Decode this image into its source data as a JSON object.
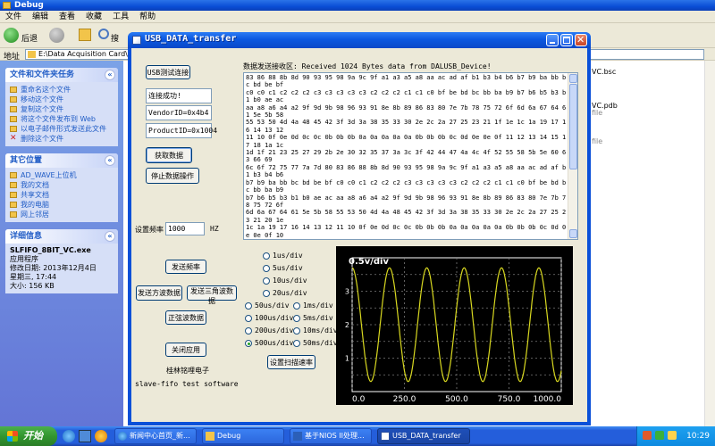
{
  "explorer": {
    "title": "Debug",
    "menu": [
      "文件",
      "编辑",
      "查看",
      "收藏",
      "工具",
      "帮助"
    ],
    "toolbar": {
      "back": "后退",
      "search": "搜"
    },
    "address_label": "地址",
    "address_value": "E:\\Data Acquisition Card\\",
    "file_tasks": {
      "title": "文件和文件夹任务",
      "items": [
        "重命名这个文件",
        "移动这个文件",
        "复制这个文件",
        "将这个文件发布到 Web",
        "以电子邮件形式发送此文件",
        "删除这个文件"
      ]
    },
    "other_places": {
      "title": "其它位置",
      "items": [
        "AD_WAVE上位机",
        "我的文档",
        "共享文档",
        "我的电脑",
        "网上邻居"
      ]
    },
    "details": {
      "title": "详细信息",
      "name": "SLFIFO_8BIT_VC.exe",
      "type": "应用程序",
      "modified_label": "修改日期: 2013年12月4日",
      "modified_time": "星期三, 17:44",
      "size": "大小: 156 KB"
    },
    "files": [
      {
        "name": "VC.bsc",
        "sub": ""
      },
      {
        "name": "VC.pdb",
        "sub": "file"
      },
      {
        "name": "",
        "sub": "file"
      }
    ]
  },
  "taskbar": {
    "start": "开始",
    "tasks": [
      "新闻中心首页_新...",
      "Debug",
      "基于NIOS II处理...",
      "USB_DATA_transfer"
    ],
    "clock": "10:29"
  },
  "usb_window": {
    "title": "USB_DATA_transfer",
    "buttons": {
      "test_connect": "USB测试连接",
      "get_data": "获取数据",
      "stop_data": "停止数据操作",
      "send_freq": "发送频率",
      "send_square": "发送方波数据",
      "send_triangle": "发送三角波数据",
      "sine_data": "正弦波数据",
      "close_app": "关闭应用",
      "set_scan_rate": "设置扫描速率"
    },
    "fields": {
      "status": "连接成功!",
      "vendor_id": "VendorID=0x4b4",
      "product_id": "ProductID=0x1004",
      "freq_value": "1000"
    },
    "labels": {
      "receive_header": "数据发送接收区: Received 1024 Bytes data from DALUSB_Device!",
      "set_freq": "设置频率",
      "freq_unit": "HZ",
      "company": "桂林铭哩电子",
      "software": "slave-fifo test software"
    },
    "data_lines": [
      "83 86 88 8b 8d 90 93 95 98 9a 9c 9f a1 a3 a5 a8 aa ac ad af b1 b3 b4 b6 b7 b9 ba bb bc bd be bf",
      "c0 c0 c1 c2 c2 c2 c3 c3 c3 c3 c3 c2 c2 c2 c1 c1 c0 bf be bd bc bb ba b9 b7 b6 b5 b3 b1 b0 ae ac",
      "aa a8 a6 a4 a2 9f 9d 9b 98 96 93 91 8e 8b 89 86 83 80 7e 7b 78 75 72 6f 6d 6a 67 64 61 5e 5b 58",
      "55 53 50 4d 4a 48 45 42 3f 3d 3a 38 35 33 30 2e 2c 2a 27 25 23 21 1f 1e 1c 1a 19 17 16 14 13 12",
      "11 10 0f 0e 0d 0c 0c 0b 0b 0b 0a 0a 0a 0a 0a 0b 0b 0b 0c 0d 0e 0e 0f 11 12 13 14 15 17 18 1a 1c",
      "1d 1f 21 23 25 27 29 2b 2e 30 32 35 37 3a 3c 3f 42 44 47 4a 4c 4f 52 55 58 5b 5e 60 63 66 69",
      "6c 6f 72 75 77 7a 7d 80 83 86 88 8b 8d 90 93 95 98 9a 9c 9f a1 a3 a5 a8 aa ac ad af b1 b3 b4 b6",
      "b7 b9 ba bb bc bd be bf c0 c0 c1 c2 c2 c2 c3 c3 c3 c3 c3 c2 c2 c2 c1 c1 c0 bf be bd bc bb ba b9",
      "b7 b6 b5 b3 b1 b0 ae ac aa a8 a6 a4 a2 9f 9d 9b 98 96 93 91 8e 8b 89 86 83 80 7e 7b 78 75 72 6f",
      "6d 6a 67 64 61 5e 5b 58 55 53 50 4d 4a 48 45 42 3f 3d 3a 38 35 33 30 2e 2c 2a 27 25 23 21 20 1e",
      "1c 1a 19 17 16 14 13 12 11 10 0f 0e 0d 0c 0c 0b 0b 0b 0a 0a 0a 0a 0a 0b 0b 0b 0c 0d 0e 0e 0f 10",
      "11 12 13 14 15 17 18 1a 1c 1d 1f 21 23 25 27 29 2b 2e 30 32 35 37 3a 3c 3f 42 44 47 4a 4c 4f 52",
      "55 58 5b 5e 60 63 66 69 6c 6f 72 75 77 7a 7d 80 83 86 88 8b 8d 90 93 95 98 9a 9c 9f a1 a3 a5 a8",
      "aa ac ad af b1 b3 b4 b6 b7 b9 ba bb bc bd be bf c0 c0 c1 c2 c2 c2 c3 c3 c3 c3 c3 c2 c2 c2 c1 c1",
      "c0 bf be bd bc bb ba b9 b7 b6 b5 b3 b1 b0 ae ac aa a8 a6 a4 a2 9f 9d 9b 98 96 93 91 8e 8b 89 86",
      "83 80 7e 7b 78 75 72 6f 6d 6a 67 64 61 5e 5b 58 55 53 50 4d 4a 48 45 42 3f 3d 3a 38 35 33 30 2e",
      "2c 2a 27 25 23 21 20 1e 1c 1a 19 17 16 14 13 12 11 10 0f 0e 0d 0c 0c 0b 0b 0b 0a 0a 0a 0a 0a 0b",
      "0b 0b 0c 0d 0e 0e 0f 10 11 12 13 14 15 17 18 1a 1c 1d 1f 21 23 25 27 29 2b 2e 30 32 35 37 3a 3c",
      "3f 42 44 47 4a 4c 4f 52 55 58 5b 5e 60 63 66 69 6c 6f 72 75 77 7a 7d 80 83 86 88 8b 8d 90 93 95",
      "98 9a 9c 9f a1 a3 a5 a8 aa ac ad af b1 b3 b4 b6 b7 b9 ba bb bc bd be bf c0 c0 c1 c2 c2 c2 c3 c3",
      "c3 c3 c3 c2 c2 c2 c1 c1 c0 bf be bd bc bb ba b9 b7 b6 b5 b3 b1 b0 ae ac aa a8 a6 a4 a2 9f 9d 9b",
      "98 96 93 91 8e 8b 89 86 83 80 7e 7b 78 75 72 6f 6d 6a 67 64 61 5e 5b 58 55 53 50 4d 4a 48 45 42"
    ],
    "scan_rates": {
      "top": [
        "1us/div",
        "5us/div",
        "10us/div",
        "20us/div"
      ],
      "left": [
        "50us/div",
        "100us/div",
        "200us/div",
        "500us/div"
      ],
      "right": [
        "1ms/div",
        "5ms/div",
        "10ms/div",
        "50ms/div"
      ],
      "selected": "500us/div"
    },
    "scope": {
      "label": "0.5v/div",
      "colors": {
        "background": "#000000",
        "grid": "#7a7a7a",
        "trace": "#d8d820",
        "text": "#ffffff"
      }
    }
  },
  "chart_data": {
    "type": "line",
    "title": "0.5v/div",
    "xlabel": "",
    "ylabel": "",
    "xlim": [
      0,
      1000
    ],
    "ylim": [
      0,
      4
    ],
    "xticks": [
      "0.0",
      "250.0",
      "500.0",
      "750.0",
      "1000.0"
    ],
    "yticks": [
      "0.5",
      "1",
      "1.5",
      "2",
      "2.5",
      "3",
      "3.5"
    ],
    "grid": true,
    "series": [
      {
        "kind": "sine",
        "amplitude": 1.7,
        "offset": 2.0,
        "cycles": 5.6,
        "phase_deg": 90
      }
    ]
  }
}
